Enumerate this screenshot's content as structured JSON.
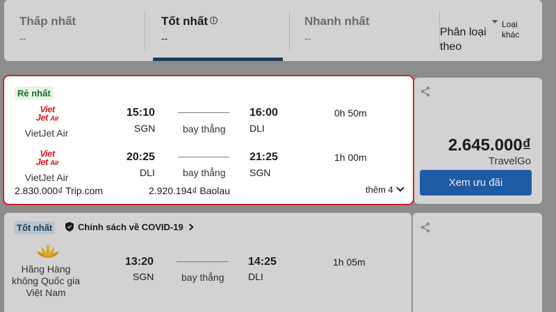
{
  "sort_bar": {
    "tabs": [
      {
        "label": "Thấp nhất",
        "value": "--"
      },
      {
        "label": "Tốt nhất",
        "value": "--"
      },
      {
        "label": "Nhanh nhất",
        "value": "--"
      }
    ],
    "sort_by_label": "Phân loại theo",
    "other_sort_label": "Loại khác"
  },
  "cheapest": {
    "badge": "Rẻ nhất",
    "legs": [
      {
        "airline_logo": "VietJet Air",
        "airline_name": "VietJet Air",
        "depart_time": "15:10",
        "depart_code": "SGN",
        "stops": "bay thẳng",
        "arrive_time": "16:00",
        "arrive_code": "DLI",
        "duration": "0h 50m"
      },
      {
        "airline_logo": "VietJet Air",
        "airline_name": "VietJet Air",
        "depart_time": "20:25",
        "depart_code": "DLI",
        "stops": "bay thẳng",
        "arrive_time": "21:25",
        "arrive_code": "SGN",
        "duration": "1h 00m"
      }
    ],
    "other_prices": [
      {
        "text": "2.830.000₫ Trip.com"
      },
      {
        "text": "2.920.194₫ Baolau"
      }
    ],
    "more_label": "thêm 4",
    "price": "2.645.000₫",
    "provider": "TravelGo",
    "deal_button": "Xem ưu đãi"
  },
  "best": {
    "badge": "Tốt nhất",
    "covid_policy": "Chính sách về COVID-19",
    "legs": [
      {
        "airline_name": "Hãng Hàng không Quốc gia Việt Nam",
        "depart_time": "13:20",
        "depart_code": "SGN",
        "stops": "bay thẳng",
        "arrive_time": "14:25",
        "arrive_code": "DLI",
        "duration": "1h 05m"
      }
    ]
  },
  "colors": {
    "highlight_border": "#d0202b",
    "primary_button": "#1f5aa5",
    "active_tab_underline": "#1f3b57"
  }
}
